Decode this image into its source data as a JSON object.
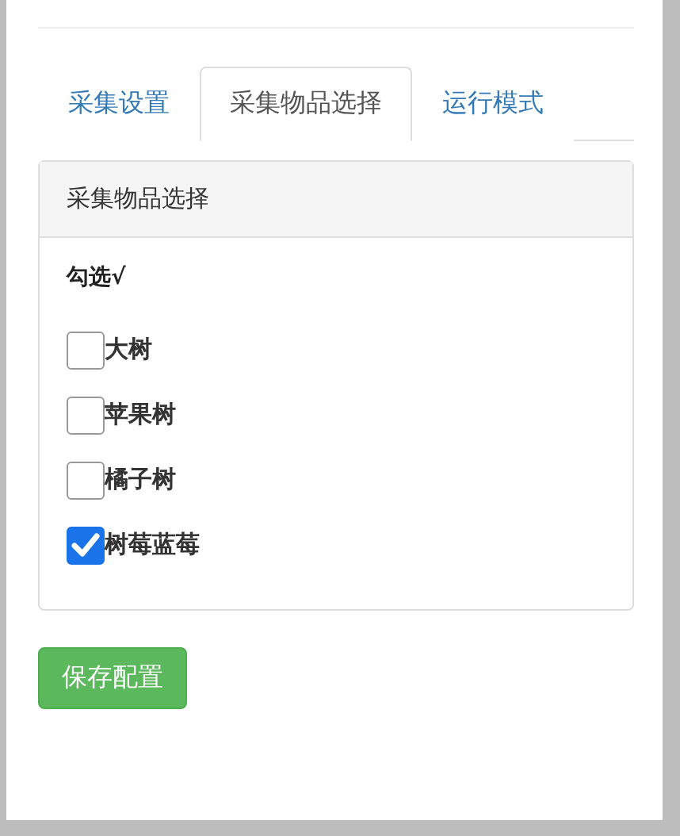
{
  "tabs": [
    {
      "label": "采集设置",
      "selected": false
    },
    {
      "label": "采集物品选择",
      "selected": true
    },
    {
      "label": "运行模式",
      "selected": false
    }
  ],
  "panel": {
    "title": "采集物品选择",
    "heading": "勾选√",
    "items": [
      {
        "label": "大树",
        "checked": false
      },
      {
        "label": "苹果树",
        "checked": false
      },
      {
        "label": "橘子树",
        "checked": false
      },
      {
        "label": "树莓蓝莓",
        "checked": true
      }
    ]
  },
  "save_button": "保存配置"
}
